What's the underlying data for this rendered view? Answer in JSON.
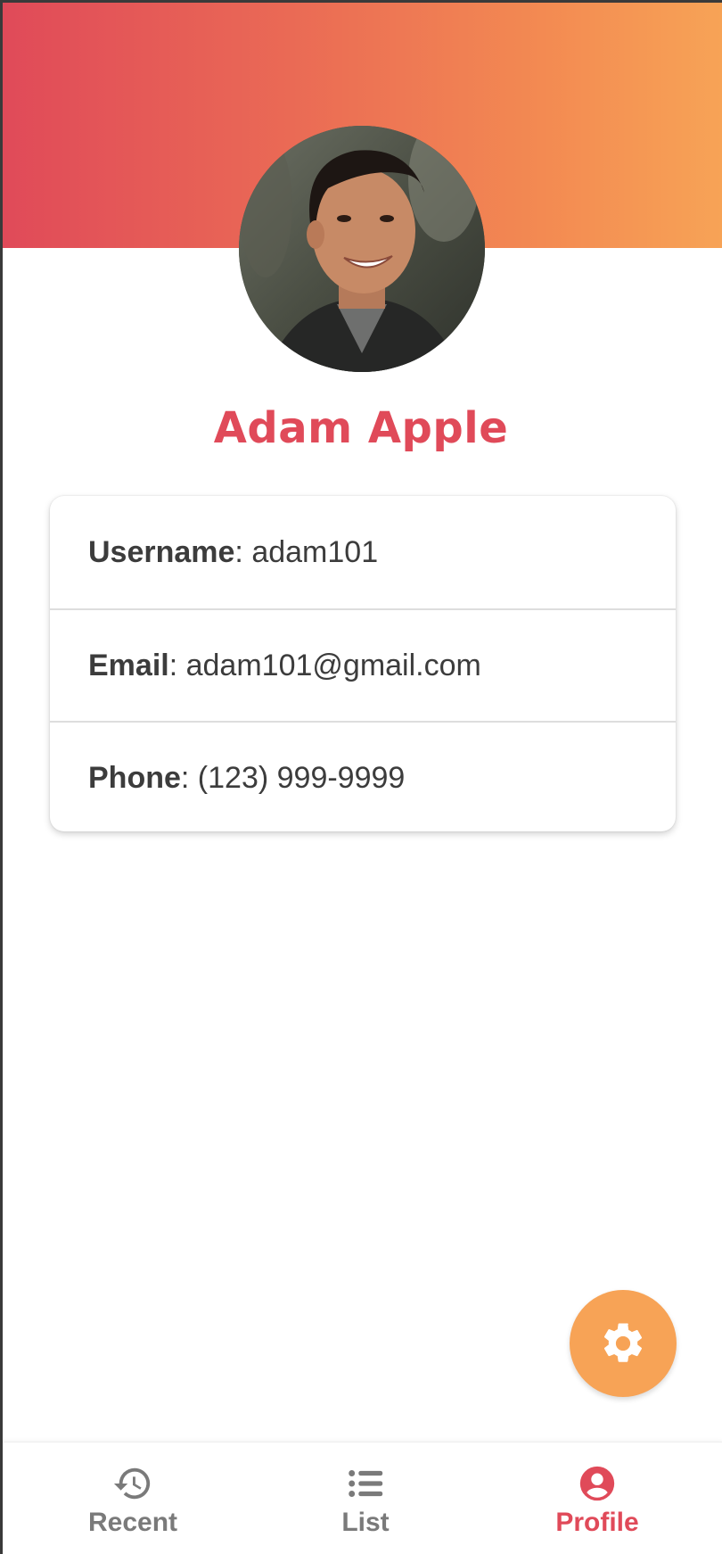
{
  "profile": {
    "name": "Adam Apple",
    "avatar_alt": "profile photo"
  },
  "details": [
    {
      "label": "Username",
      "separator": ":",
      "value": " adam101"
    },
    {
      "label": "Email",
      "separator": ":",
      "value": " adam101@gmail.com"
    },
    {
      "label": "Phone",
      "separator": ":",
      "value": " (123) 999-9999"
    }
  ],
  "fab": {
    "icon": "gear-icon"
  },
  "nav": {
    "items": [
      {
        "label": "Recent",
        "icon": "history-icon",
        "active": false
      },
      {
        "label": "List",
        "icon": "list-icon",
        "active": false
      },
      {
        "label": "Profile",
        "icon": "account-circle-icon",
        "active": true
      }
    ]
  },
  "colors": {
    "accent": "#e04a59",
    "gradient_start": "#e04a59",
    "gradient_end": "#f7a356",
    "fab": "#f7a356",
    "inactive_nav": "#7a7a7a"
  }
}
